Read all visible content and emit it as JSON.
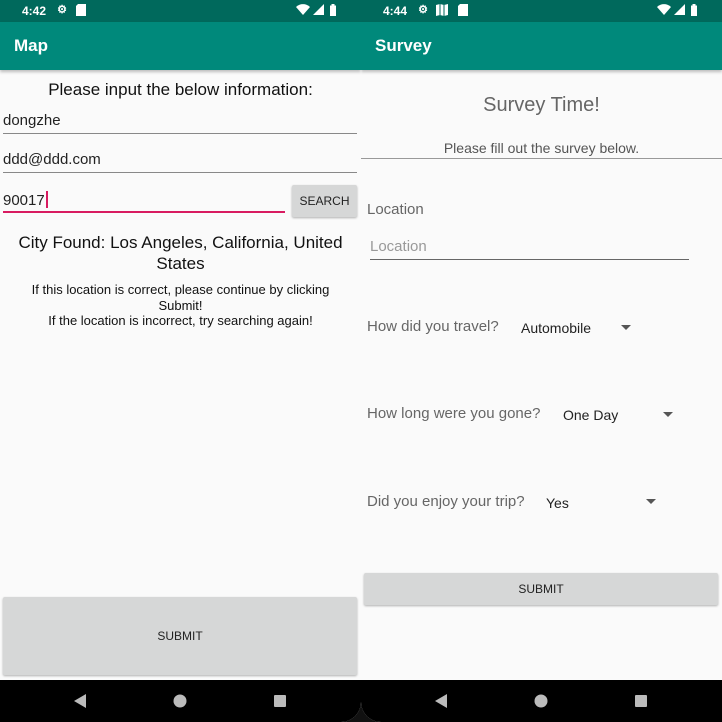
{
  "left": {
    "status": {
      "time": "4:42"
    },
    "app_title": "Map",
    "prompt": "Please input the below information:",
    "name_value": "dongzhe",
    "email_value": "ddd@ddd.com",
    "zip_value": "90017",
    "search_label": "SEARCH",
    "city_found": "City Found: Los Angeles, California, United States",
    "instructions_line1": "If this location is correct, please continue by clicking Submit!",
    "instructions_line2": "If the location is incorrect, try searching again!",
    "submit_label": "SUBMIT"
  },
  "right": {
    "status": {
      "time": "4:44"
    },
    "app_title": "Survey",
    "heading": "Survey Time!",
    "subheading": "Please fill out the survey below.",
    "location_label": "Location",
    "location_placeholder": "Location",
    "travel_question": "How did you travel?",
    "travel_value": "Automobile",
    "duration_question": "How long were you gone?",
    "duration_value": "One Day",
    "enjoy_question": "Did you enjoy your trip?",
    "enjoy_value": "Yes",
    "submit_label": "SUBMIT"
  },
  "icons": [
    "gear-icon",
    "sd-card-icon",
    "map-icon",
    "wifi-icon",
    "signal-icon",
    "battery-icon",
    "back-icon",
    "home-icon",
    "recents-icon"
  ],
  "colors": {
    "appbar": "#00897b",
    "statusbar": "#00695c",
    "accent": "#d81b60"
  }
}
